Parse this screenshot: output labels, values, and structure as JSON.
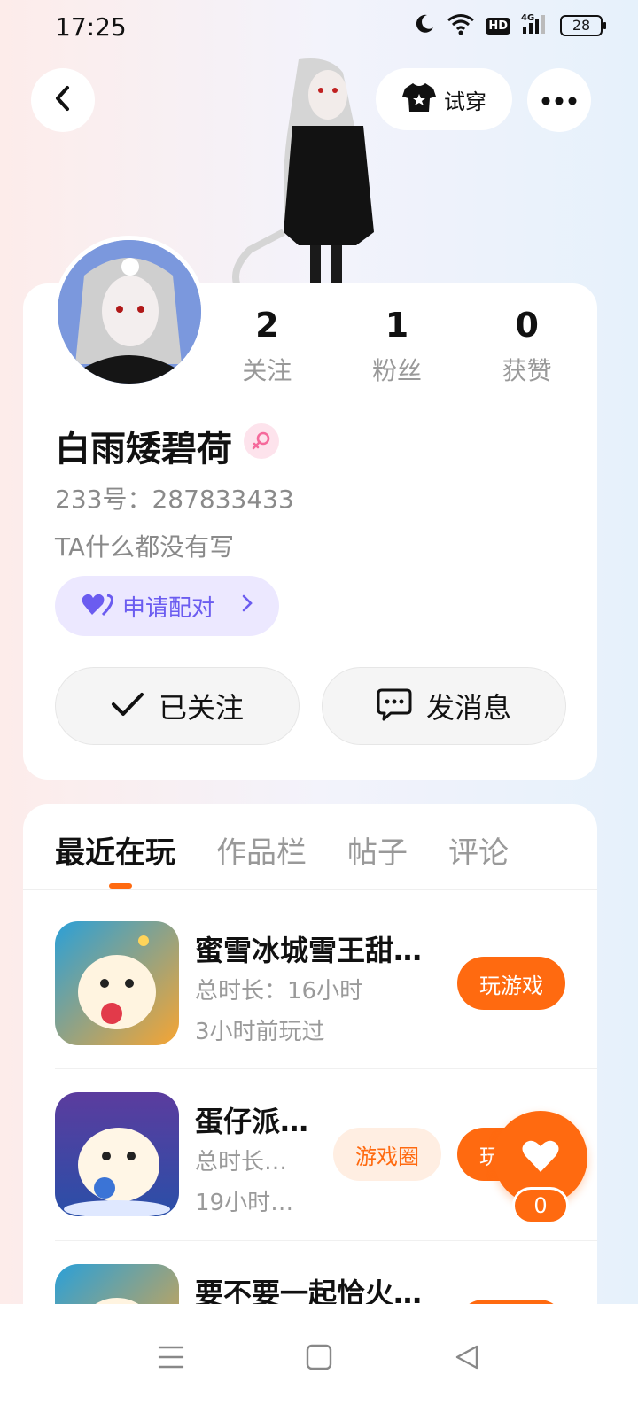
{
  "status_bar": {
    "time": "17:25",
    "icons": [
      "moon-icon",
      "wifi-icon",
      "hd-icon",
      "signal-4g-icon",
      "battery-icon"
    ],
    "hd_label": "HD",
    "battery": "28"
  },
  "header": {
    "back_icon": "back-arrow-icon",
    "tryon_icon": "tshirt-icon",
    "tryon_label": "试穿",
    "more_icon": "more-dots-icon"
  },
  "profile": {
    "stats": [
      {
        "value": "2",
        "label": "关注"
      },
      {
        "value": "1",
        "label": "粉丝"
      },
      {
        "value": "0",
        "label": "获赞"
      }
    ],
    "username": "白雨矮碧荷",
    "gender_icon": "female-icon",
    "uid": "233号：287833433",
    "bio": "TA什么都没有写",
    "pair_label": "申请配对",
    "follow_label": "已关注",
    "message_label": "发消息"
  },
  "tabs": [
    {
      "label": "最近在玩",
      "active": true
    },
    {
      "label": "作品栏",
      "active": false
    },
    {
      "label": "帖子",
      "active": false
    },
    {
      "label": "评论",
      "active": false
    }
  ],
  "games": [
    {
      "name": "蜜雪冰城雪王甜…",
      "duration": "总时长：16小时",
      "last_played": "3小时前玩过",
      "play_label": "玩游戏"
    },
    {
      "name": "蛋仔派…",
      "duration": "总时长…",
      "last_played": "19小时…",
      "circle_label": "游戏圈",
      "play_label": "玩游戏"
    },
    {
      "name": "要不要一起恰火…"
    }
  ],
  "like": {
    "count": "0"
  },
  "colors": {
    "accent": "#ff6a10",
    "pair": "#6b5cf0",
    "female": "#f56a9b"
  }
}
